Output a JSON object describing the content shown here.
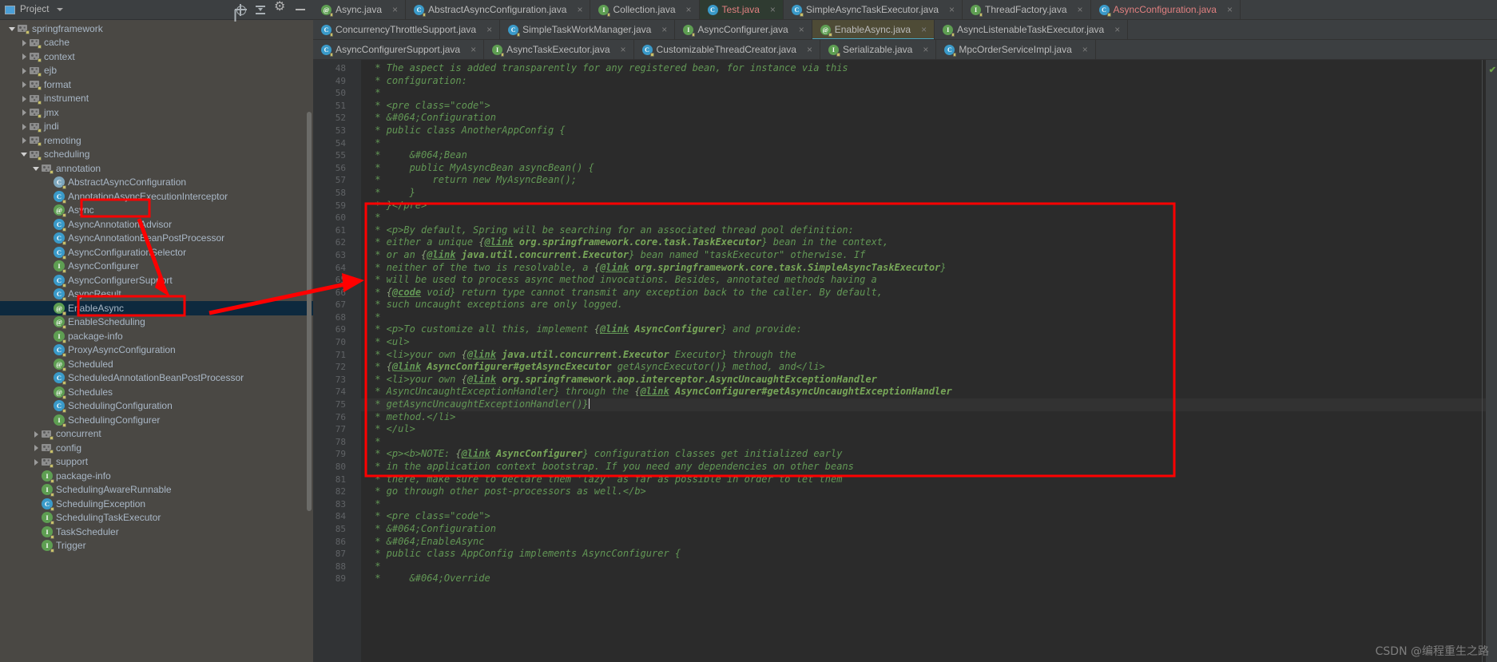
{
  "project_panel": {
    "title": "Project",
    "icons": [
      "project-icon",
      "chevron-down-icon",
      "locate-icon",
      "collapse-all-icon"
    ],
    "tree": [
      {
        "depth": 1,
        "arrow": "open",
        "icon": "package-icon",
        "label": "springframework"
      },
      {
        "depth": 2,
        "arrow": "closed",
        "icon": "package-icon",
        "label": "cache"
      },
      {
        "depth": 2,
        "arrow": "closed",
        "icon": "package-icon",
        "label": "context"
      },
      {
        "depth": 2,
        "arrow": "closed",
        "icon": "package-icon",
        "label": "ejb"
      },
      {
        "depth": 2,
        "arrow": "closed",
        "icon": "package-icon",
        "label": "format"
      },
      {
        "depth": 2,
        "arrow": "closed",
        "icon": "package-icon",
        "label": "instrument"
      },
      {
        "depth": 2,
        "arrow": "closed",
        "icon": "package-icon",
        "label": "jmx"
      },
      {
        "depth": 2,
        "arrow": "closed",
        "icon": "package-icon",
        "label": "jndi"
      },
      {
        "depth": 2,
        "arrow": "closed",
        "icon": "package-icon",
        "label": "remoting"
      },
      {
        "depth": 2,
        "arrow": "open",
        "icon": "package-icon",
        "label": "scheduling"
      },
      {
        "depth": 3,
        "arrow": "open",
        "icon": "package-icon",
        "label": "annotation"
      },
      {
        "depth": 4,
        "arrow": "none",
        "icon": "abstract-class-icon",
        "label": "AbstractAsyncConfiguration"
      },
      {
        "depth": 4,
        "arrow": "none",
        "icon": "class-icon",
        "label": "AnnotationAsyncExecutionInterceptor"
      },
      {
        "depth": 4,
        "arrow": "none",
        "icon": "annotation-icon",
        "label": "Async",
        "boxed": true
      },
      {
        "depth": 4,
        "arrow": "none",
        "icon": "class-icon",
        "label": "AsyncAnnotationAdvisor"
      },
      {
        "depth": 4,
        "arrow": "none",
        "icon": "class-icon",
        "label": "AsyncAnnotationBeanPostProcessor"
      },
      {
        "depth": 4,
        "arrow": "none",
        "icon": "class-icon",
        "label": "AsyncConfigurationSelector"
      },
      {
        "depth": 4,
        "arrow": "none",
        "icon": "interface-icon",
        "label": "AsyncConfigurer"
      },
      {
        "depth": 4,
        "arrow": "none",
        "icon": "class-icon",
        "label": "AsyncConfigurerSupport"
      },
      {
        "depth": 4,
        "arrow": "none",
        "icon": "class-icon",
        "label": "AsyncResult"
      },
      {
        "depth": 4,
        "arrow": "none",
        "icon": "annotation-icon",
        "label": "EnableAsync",
        "selected": true,
        "boxed": true
      },
      {
        "depth": 4,
        "arrow": "none",
        "icon": "annotation-icon",
        "label": "EnableScheduling"
      },
      {
        "depth": 4,
        "arrow": "none",
        "icon": "interface-icon",
        "label": "package-info"
      },
      {
        "depth": 4,
        "arrow": "none",
        "icon": "class-icon",
        "label": "ProxyAsyncConfiguration"
      },
      {
        "depth": 4,
        "arrow": "none",
        "icon": "annotation-icon",
        "label": "Scheduled"
      },
      {
        "depth": 4,
        "arrow": "none",
        "icon": "class-icon",
        "label": "ScheduledAnnotationBeanPostProcessor"
      },
      {
        "depth": 4,
        "arrow": "none",
        "icon": "annotation-icon",
        "label": "Schedules"
      },
      {
        "depth": 4,
        "arrow": "none",
        "icon": "class-icon",
        "label": "SchedulingConfiguration"
      },
      {
        "depth": 4,
        "arrow": "none",
        "icon": "interface-icon",
        "label": "SchedulingConfigurer"
      },
      {
        "depth": 3,
        "arrow": "closed",
        "icon": "package-icon",
        "label": "concurrent"
      },
      {
        "depth": 3,
        "arrow": "closed",
        "icon": "package-icon",
        "label": "config"
      },
      {
        "depth": 3,
        "arrow": "closed",
        "icon": "package-icon",
        "label": "support"
      },
      {
        "depth": 3,
        "arrow": "none",
        "icon": "interface-icon",
        "label": "package-info"
      },
      {
        "depth": 3,
        "arrow": "none",
        "icon": "interface-icon",
        "label": "SchedulingAwareRunnable"
      },
      {
        "depth": 3,
        "arrow": "none",
        "icon": "class-icon",
        "label": "SchedulingException"
      },
      {
        "depth": 3,
        "arrow": "none",
        "icon": "interface-icon",
        "label": "SchedulingTaskExecutor"
      },
      {
        "depth": 3,
        "arrow": "none",
        "icon": "interface-icon",
        "label": "TaskScheduler"
      },
      {
        "depth": 3,
        "arrow": "none",
        "icon": "interface-icon",
        "label": "Trigger"
      }
    ]
  },
  "editor_tabs": {
    "row1": [
      {
        "label": "Async.java",
        "icon": "annotation-icon",
        "state": "normal"
      },
      {
        "label": "AbstractAsyncConfiguration.java",
        "icon": "class-icon",
        "state": "normal"
      },
      {
        "label": "Collection.java",
        "icon": "interface-icon",
        "state": "normal"
      },
      {
        "label": "Test.java",
        "icon": "test-class-icon",
        "state": "highlight-green",
        "red_text": true
      },
      {
        "label": "SimpleAsyncTaskExecutor.java",
        "icon": "class-icon",
        "state": "normal"
      },
      {
        "label": "ThreadFactory.java",
        "icon": "interface-icon",
        "state": "normal"
      },
      {
        "label": "AsyncConfiguration.java",
        "icon": "class-icon",
        "state": "normal",
        "red_text": true
      }
    ],
    "row2": [
      {
        "label": "ConcurrencyThrottleSupport.java",
        "icon": "class-icon",
        "state": "normal"
      },
      {
        "label": "SimpleTaskWorkManager.java",
        "icon": "class-icon",
        "state": "normal"
      },
      {
        "label": "AsyncConfigurer.java",
        "icon": "interface-icon",
        "state": "normal"
      },
      {
        "label": "EnableAsync.java",
        "icon": "annotation-icon",
        "state": "active"
      },
      {
        "label": "AsyncListenableTaskExecutor.java",
        "icon": "interface-icon",
        "state": "normal"
      }
    ],
    "row3": [
      {
        "label": "AsyncConfigurerSupport.java",
        "icon": "class-icon",
        "state": "normal"
      },
      {
        "label": "AsyncTaskExecutor.java",
        "icon": "interface-icon",
        "state": "normal"
      },
      {
        "label": "CustomizableThreadCreator.java",
        "icon": "class-icon",
        "state": "normal"
      },
      {
        "label": "Serializable.java",
        "icon": "interface-icon",
        "state": "normal"
      },
      {
        "label": "MpcOrderServiceImpl.java",
        "icon": "class-icon",
        "state": "normal"
      }
    ]
  },
  "code": {
    "first_line_number": 48,
    "lines": [
      {
        "n": 48,
        "text": " * The aspect is added transparently for any registered bean, for instance via this"
      },
      {
        "n": 49,
        "text": " * configuration:"
      },
      {
        "n": 50,
        "text": " *"
      },
      {
        "n": 51,
        "text": " * <pre class=\"code\">"
      },
      {
        "n": 52,
        "text": " * &#064;Configuration"
      },
      {
        "n": 53,
        "text": " * public class AnotherAppConfig {"
      },
      {
        "n": 54,
        "text": " *"
      },
      {
        "n": 55,
        "text": " *     &#064;Bean"
      },
      {
        "n": 56,
        "text": " *     public MyAsyncBean asyncBean() {"
      },
      {
        "n": 57,
        "text": " *         return new MyAsyncBean();"
      },
      {
        "n": 58,
        "text": " *     }"
      },
      {
        "n": 59,
        "text": " * }</pre>"
      },
      {
        "n": 60,
        "text": " *"
      },
      {
        "n": 61,
        "text": " * <p>By default, Spring will be searching for an associated thread pool definition:"
      },
      {
        "n": 62,
        "text": " * either a unique {@link org.springframework.core.task.TaskExecutor} bean in the context,"
      },
      {
        "n": 63,
        "text": " * or an {@link java.util.concurrent.Executor} bean named \"taskExecutor\" otherwise. If"
      },
      {
        "n": 64,
        "text": " * neither of the two is resolvable, a {@link org.springframework.core.task.SimpleAsyncTaskExecutor}"
      },
      {
        "n": 65,
        "text": " * will be used to process async method invocations. Besides, annotated methods having a"
      },
      {
        "n": 66,
        "text": " * {@code void} return type cannot transmit any exception back to the caller. By default,"
      },
      {
        "n": 67,
        "text": " * such uncaught exceptions are only logged."
      },
      {
        "n": 68,
        "text": " *"
      },
      {
        "n": 69,
        "text": " * <p>To customize all this, implement {@link AsyncConfigurer} and provide:"
      },
      {
        "n": 70,
        "text": " * <ul>"
      },
      {
        "n": 71,
        "text": " * <li>your own {@link java.util.concurrent.Executor Executor} through the"
      },
      {
        "n": 72,
        "text": " * {@link AsyncConfigurer#getAsyncExecutor getAsyncExecutor()} method, and</li>"
      },
      {
        "n": 73,
        "text": " * <li>your own {@link org.springframework.aop.interceptor.AsyncUncaughtExceptionHandler"
      },
      {
        "n": 74,
        "text": " * AsyncUncaughtExceptionHandler} through the {@link AsyncConfigurer#getAsyncUncaughtExceptionHandler"
      },
      {
        "n": 75,
        "text": " * getAsyncUncaughtExceptionHandler()}"
      },
      {
        "n": 76,
        "text": " * method.</li>"
      },
      {
        "n": 77,
        "text": " * </ul>"
      },
      {
        "n": 78,
        "text": " *"
      },
      {
        "n": 79,
        "text": " * <p><b>NOTE: {@link AsyncConfigurer} configuration classes get initialized early"
      },
      {
        "n": 80,
        "text": " * in the application context bootstrap. If you need any dependencies on other beans"
      },
      {
        "n": 81,
        "text": " * there, make sure to declare them 'lazy' as far as possible in order to let them"
      },
      {
        "n": 82,
        "text": " * go through other post-processors as well.</b>"
      },
      {
        "n": 83,
        "text": " *"
      },
      {
        "n": 84,
        "text": " * <pre class=\"code\">"
      },
      {
        "n": 85,
        "text": " * &#064;Configuration"
      },
      {
        "n": 86,
        "text": " * &#064;EnableAsync"
      },
      {
        "n": 87,
        "text": " * public class AppConfig implements AsyncConfigurer {"
      },
      {
        "n": 88,
        "text": " *"
      },
      {
        "n": 89,
        "text": " *     &#064;Override"
      }
    ]
  },
  "annotations": {
    "box_color": "#ff0000",
    "arrow_color": "#ff0000",
    "highlight_boxes": [
      "tree-item-async",
      "tree-item-enableasync",
      "code-javadoc-paragraph"
    ],
    "arrows": [
      "async-to-asyncresult",
      "enableasync-to-javadoc"
    ]
  },
  "watermark": "CSDN @编程重生之路",
  "status": {
    "inspection": "✔"
  }
}
